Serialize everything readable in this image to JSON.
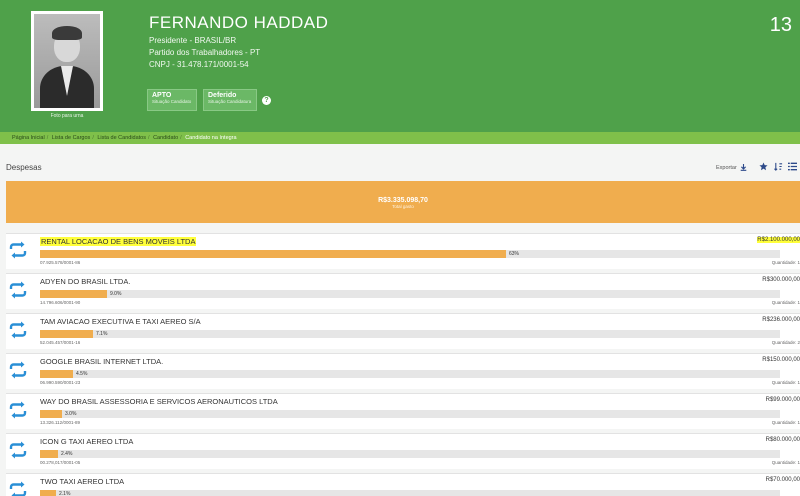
{
  "candidate": {
    "name": "FERNANDO HADDAD",
    "office": "Presidente - BRASIL/BR",
    "party": "Partido dos Trabalhadores - PT",
    "cnpj": "CNPJ - 31.478.171/0001-54",
    "number": "13",
    "photo_caption": "Foto para urna",
    "status_badges": [
      {
        "main": "APTO",
        "sub": "Situação Candidato"
      },
      {
        "main": "Deferido",
        "sub": "Situação Candidatura"
      }
    ],
    "help": "?"
  },
  "breadcrumb": [
    "Página Inicial",
    "Lista de Cargos",
    "Lista de Candidatos",
    "Candidato",
    "Candidato na íntegra"
  ],
  "section": {
    "title": "Despesas",
    "export_label": "Exportar"
  },
  "total": {
    "value": "R$3.335.098,70",
    "label": "Total gasto"
  },
  "expenses": [
    {
      "name": "RENTAL LOCACAO DE BENS MOVEIS LTDA",
      "value": "R$2.100.000,00",
      "pct_label": "63%",
      "pct": 0.63,
      "cnpj": "07.925.578/0001-86",
      "qty": "Quantidade: 1",
      "highlight": true
    },
    {
      "name": "ADYEN DO BRASIL LTDA.",
      "value": "R$300.000,00",
      "pct_label": "9.0%",
      "pct": 0.09,
      "cnpj": "14.796.606/0001-90",
      "qty": "Quantidade: 1",
      "highlight": false
    },
    {
      "name": "TAM AVIACAO EXECUTIVA E TAXI AEREO S/A",
      "value": "R$236.000,00",
      "pct_label": "7.1%",
      "pct": 0.071,
      "cnpj": "52.045.457/0001-16",
      "qty": "Quantidade: 2",
      "highlight": false
    },
    {
      "name": "GOOGLE BRASIL INTERNET LTDA.",
      "value": "R$150.000,00",
      "pct_label": "4.5%",
      "pct": 0.045,
      "cnpj": "06.990.590/0001-23",
      "qty": "Quantidade: 1",
      "highlight": false
    },
    {
      "name": "WAY DO BRASIL ASSESSORIA E SERVICOS AERONAUTICOS LTDA",
      "value": "R$99.000,00",
      "pct_label": "3.0%",
      "pct": 0.03,
      "cnpj": "13.326.112/0001-89",
      "qty": "Quantidade: 1",
      "highlight": false
    },
    {
      "name": "ICON G TAXI AEREO LTDA",
      "value": "R$80.000,00",
      "pct_label": "2.4%",
      "pct": 0.024,
      "cnpj": "00.278,017/0001-05",
      "qty": "Quantidade: 1",
      "highlight": false
    },
    {
      "name": "TWO TAXI AEREO LTDA",
      "value": "R$70.000,00",
      "pct_label": "2.1%",
      "pct": 0.021,
      "cnpj": "",
      "qty": "",
      "highlight": false
    }
  ],
  "colors": {
    "header": "#4fa14a",
    "breadcrumb": "#7fc04a",
    "bar": "#f0ad4e",
    "highlight": "#ffff3a",
    "icon": "#2a8fd6"
  },
  "icons": {
    "row": "repeat-arrows-icon",
    "export": "download-icon",
    "star": "star-icon",
    "sort": "sort-icon",
    "list": "list-icon"
  }
}
